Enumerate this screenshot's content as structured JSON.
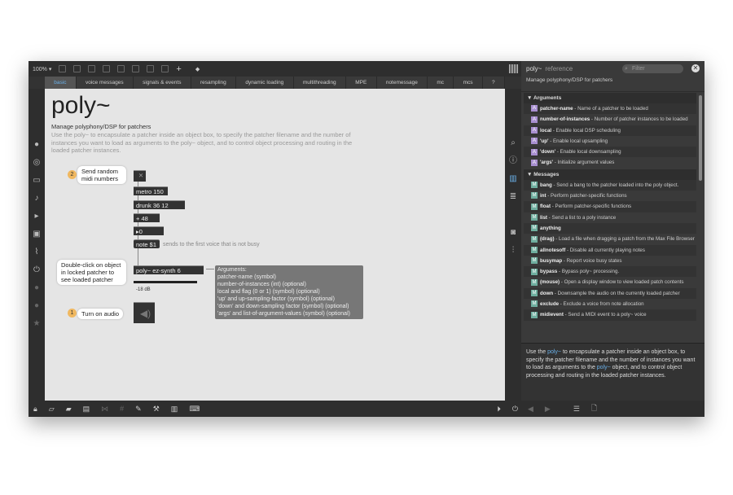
{
  "toolbar": {
    "zoom": "100% ▾"
  },
  "tabs": [
    "basic",
    "voice messages",
    "signals & events",
    "resampling",
    "dynamic loading",
    "multithreading",
    "MPE",
    "notemessage",
    "mc",
    "mcs",
    "?"
  ],
  "patch": {
    "title": "poly~",
    "subtitle": "Manage polyphony/DSP for patchers",
    "description": "Use the poly~ to encapsulate a patcher inside an object box, to specify the patcher filename and the number of instances you want to load as arguments to the poly~ object, and to control object processing and routing in the loaded patcher instances.",
    "step2_num": "2",
    "step2": "Send random midi numbers",
    "objects": {
      "metro": "metro 150",
      "drunk": "drunk 36 12",
      "plus": "+ 48",
      "number": "▸0",
      "note": "note $1",
      "poly": "poly~ ez-synth 6"
    },
    "note_comment": "sends to the first voice that is not busy",
    "dblclick": "Double-click on object in locked patcher to see loaded patcher",
    "args_title": "Arguments:",
    "args": [
      "patcher-name (symbol)",
      "number-of-instances (int) (optional)",
      "local and flag (0 or 1) (symbol) (optional)",
      "'up' and up-sampling-factor (symbol) (optional)",
      "'down' and down-sampling factor (symbol) (optional)",
      "'args' and list-of-argument-values (symbol) (optional)"
    ],
    "gain_label": "-18 dB",
    "step1_num": "1",
    "step1": "Turn on audio"
  },
  "reference": {
    "title": "poly~",
    "title_suffix": "reference",
    "filter_placeholder": "Filter",
    "subtitle": "Manage polyphony/DSP for patchers",
    "arguments_header": "Arguments",
    "arguments": [
      {
        "name": "patcher-name",
        "desc": " - Name of a patcher to be loaded"
      },
      {
        "name": "number-of-instances",
        "desc": " - Number of patcher instances to be loaded"
      },
      {
        "name": "local",
        "desc": " - Enable local DSP scheduling"
      },
      {
        "name": "'up'",
        "desc": " - Enable local upsampling"
      },
      {
        "name": "'down'",
        "desc": " - Enable local downsampling"
      },
      {
        "name": "'args'",
        "desc": " - Initialize argument values"
      }
    ],
    "messages_header": "Messages",
    "messages": [
      {
        "name": "bang",
        "desc": " - Send a bang to the patcher loaded into the poly object."
      },
      {
        "name": "int",
        "desc": " - Perform patcher-specific functions"
      },
      {
        "name": "float",
        "desc": " - Perform patcher-specific functions"
      },
      {
        "name": "list",
        "desc": " - Send a list to a poly instance"
      },
      {
        "name": "anything",
        "desc": ""
      },
      {
        "name": "(drag)",
        "desc": " - Load a file when dragging a patch from the Max File Browser"
      },
      {
        "name": "allnotesoff",
        "desc": " - Disable all currently playing notes"
      },
      {
        "name": "busymap",
        "desc": " - Report voice busy states"
      },
      {
        "name": "bypass",
        "desc": " - Bypass poly~ processing."
      },
      {
        "name": "(mouse)",
        "desc": " - Open a display window to view loaded patch contents"
      },
      {
        "name": "down",
        "desc": " - Downsample the audio on the currently loaded patcher"
      },
      {
        "name": "exclude",
        "desc": " - Exclude a voice from note allocation"
      },
      {
        "name": "midievent",
        "desc": " - Send a MIDI event to a poly~ voice"
      }
    ],
    "desc_parts": [
      "Use the ",
      "poly~",
      " to encapsulate a patcher inside an object box, to specify the patcher filename and the number of instances you want to load as arguments to the ",
      "poly~",
      " object, and to control object processing and routing in the loaded patcher instances."
    ]
  }
}
